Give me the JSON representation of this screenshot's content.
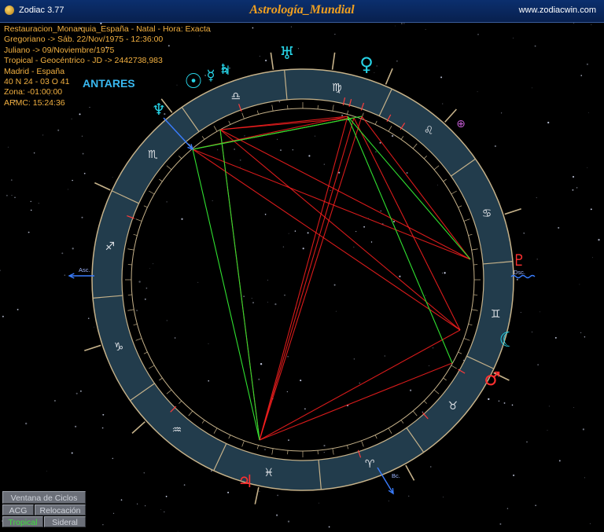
{
  "window": {
    "app_name": "Zodiac 3.77",
    "title": "Astrología_Mundial",
    "website": "www.zodiacwin.com"
  },
  "chart_info": [
    "Restauracion_Monarquia_España - Natal - Hora: Exacta",
    "Gregoriano -> Sáb. 22/Nov/1975 - 12:36:00",
    "Juliano -> 09/Noviembre/1975",
    "Tropical - Geocéntrico - JD -> 2442738,983",
    "Madrid - España",
    "40 N 24 - 03 O 41",
    "Zona: -01:00:00",
    "ARMC: 15:24:36"
  ],
  "star_label": "ANTARES",
  "axis_labels": {
    "asc": "Asc.",
    "desc": "Dsc.",
    "mc": "Mc.",
    "fc": "Bc."
  },
  "zodiac_signs": [
    "♈",
    "♉",
    "♊",
    "♋",
    "♌",
    "♍",
    "♎",
    "♏",
    "♐",
    "♑",
    "♒",
    "♓"
  ],
  "planets": [
    {
      "name": "uranus",
      "glyph": "♅",
      "color": "#27d3e6"
    },
    {
      "name": "venus",
      "glyph": "♀",
      "color": "#27d3e6"
    },
    {
      "name": "jupiter-top",
      "glyph": "♃",
      "color": "#27d3e6"
    },
    {
      "name": "sun",
      "glyph": "☉",
      "color": "#27d3e6"
    },
    {
      "name": "mercury",
      "glyph": "☿",
      "color": "#27d3e6"
    },
    {
      "name": "saturn",
      "glyph": "♄",
      "color": "#27d3e6"
    },
    {
      "name": "neptune",
      "glyph": "♆",
      "color": "#27d3e6"
    },
    {
      "name": "moon",
      "glyph": "☾",
      "color": "#27d3e6"
    },
    {
      "name": "mars",
      "glyph": "♂",
      "color": "#ff3030"
    },
    {
      "name": "jupiter",
      "glyph": "♃",
      "color": "#ff3030"
    },
    {
      "name": "pluto",
      "glyph": "♇",
      "color": "#ff3030"
    },
    {
      "name": "part-of-fortune",
      "glyph": "⊕",
      "color": "#c05ad0"
    }
  ],
  "colors": {
    "ring": "#223c4c",
    "ring_border": "#c6b28a",
    "aspect_hard": "#ff2020",
    "aspect_soft": "#30e030",
    "gold": "#f2b040"
  },
  "buttons": {
    "cycles": "Ventana de Ciclos",
    "acg": "ACG",
    "relocation": "Relocación",
    "tropical": "Tropical",
    "sidereal": "Sideral"
  }
}
